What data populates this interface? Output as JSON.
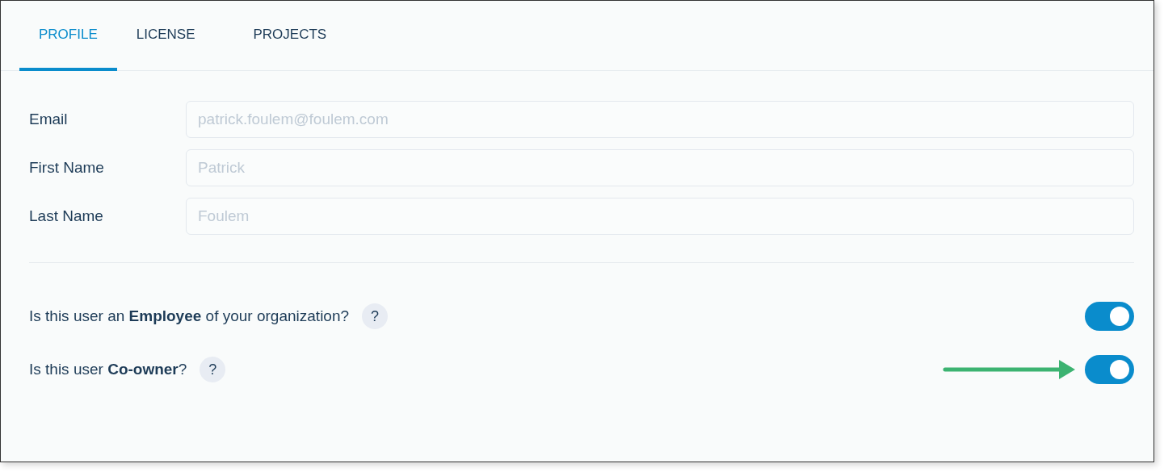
{
  "tabs": [
    {
      "label": "PROFILE",
      "selected": true
    },
    {
      "label": "LICENSE",
      "selected": false
    },
    {
      "label": "PROJECTS",
      "selected": false
    }
  ],
  "fields": [
    {
      "label": "Email",
      "placeholder": "patrick.foulem@foulem.com"
    },
    {
      "label": "First Name",
      "placeholder": "Patrick"
    },
    {
      "label": "Last Name",
      "placeholder": "Foulem"
    }
  ],
  "questions": [
    {
      "text": "Is this user an **Employee** of your organization?",
      "help": "?",
      "on": true,
      "arrow": false
    },
    {
      "text": "Is this user **Co-owner**?",
      "help": "?",
      "on": true,
      "arrow": true
    }
  ]
}
